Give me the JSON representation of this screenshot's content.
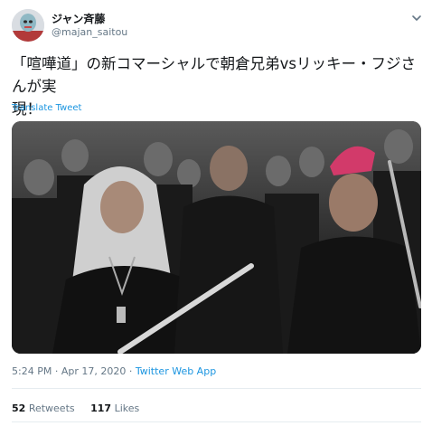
{
  "user": {
    "name": "ジャン斉藤",
    "handle": "@majan_saitou"
  },
  "tweet": {
    "text_line1": "「喧嘩道」の新コマーシャルで朝倉兄弟vsリッキー・フジさんが実",
    "text_line2": "現！",
    "translate_label": "Translate Tweet"
  },
  "meta": {
    "time": "5:24 PM",
    "separator": " · ",
    "date": "Apr 17, 2020",
    "source": "Twitter Web App"
  },
  "stats": {
    "retweets_count": "52",
    "retweets_label": "Retweets",
    "likes_count": "117",
    "likes_label": "Likes"
  },
  "icons": {
    "menu": "chevron-down-icon"
  },
  "colors": {
    "link": "#1b95e0",
    "secondary_text": "#657786",
    "divider": "#e6ecf0"
  }
}
